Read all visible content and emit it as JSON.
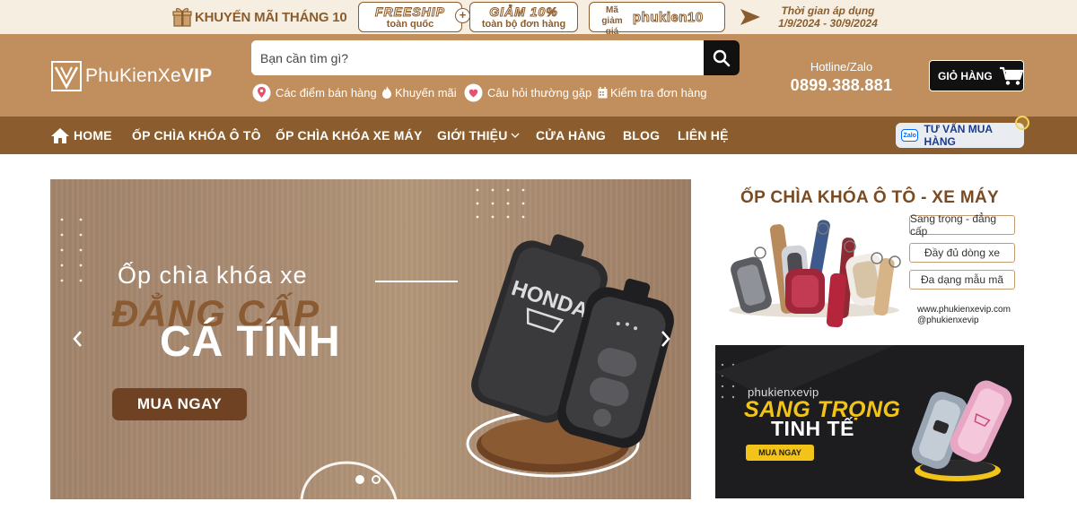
{
  "colors": {
    "promo_bg": "#f6efe1",
    "header_bg": "#c18f5d",
    "nav_bg": "#8b5d2e",
    "brand_brown": "#8b5d2e",
    "black": "#111111",
    "white": "#ffffff"
  },
  "promo": {
    "title": "KHUYẾN MÃI THÁNG 10",
    "freeship_big": "FREESHIP",
    "freeship_small": "toàn quốc",
    "plus": "+",
    "discount_big": "GIẢM 10%",
    "discount_small": "toàn bộ đơn hàng",
    "code_label": "Mã giảm giá",
    "code": "phukien10",
    "period_label": "Thời gian áp dụng",
    "period": "1/9/2024 - 30/9/2024"
  },
  "header": {
    "logo_text_plain": "PhuKienXe",
    "logo_text_bold": "VIP",
    "search_placeholder": "Bạn cần tìm gì?",
    "quick_links": [
      {
        "label": "Các điểm bán hàng",
        "icon": "map-pin-icon"
      },
      {
        "label": "Khuyến mãi",
        "icon": "fire-icon"
      },
      {
        "label": "Câu hỏi thường gặp",
        "icon": "heart-icon"
      },
      {
        "label": "Kiểm tra đơn hàng",
        "icon": "calendar-icon"
      }
    ],
    "hotline_label": "Hotline/Zalo",
    "hotline_number": "0899.388.881",
    "cart_label": "GIỎ HÀNG"
  },
  "nav": {
    "items": [
      {
        "label": "HOME",
        "icon": "home-icon"
      },
      {
        "label": "ỐP CHÌA KHÓA Ô TÔ"
      },
      {
        "label": "ỐP CHÌA KHÓA XE MÁY"
      },
      {
        "label": "GIỚI THIỆU",
        "icon": "chevron-down-icon"
      },
      {
        "label": "CỬA HÀNG"
      },
      {
        "label": "BLOG"
      },
      {
        "label": "LIÊN HỆ"
      }
    ],
    "advise_badge": "Zalo",
    "advise_label": "TƯ VẤN MUA HÀNG"
  },
  "slider": {
    "subtitle": "Ốp chìa khóa xe",
    "shadow_title": "ĐẲNG CẤP",
    "main_title": "CÁ TÍNH",
    "cta": "MUA NGAY",
    "key_logo": "HONDA",
    "active_slide": 1,
    "slide_count": 2
  },
  "banner1": {
    "title": "ỐP CHÌA KHÓA Ô TÔ - XE MÁY",
    "tags": [
      "Sang trọng - đẳng cấp",
      "Đầy đủ dòng xe",
      "Đa dạng mẫu mã"
    ],
    "website": "www.phukienxevip.com",
    "handle": "@phukienxevip"
  },
  "banner2": {
    "brand": "phukienxevip",
    "title1": "SANG TRỌNG",
    "title2": "TINH TẾ",
    "cta": "MUA NGAY"
  }
}
